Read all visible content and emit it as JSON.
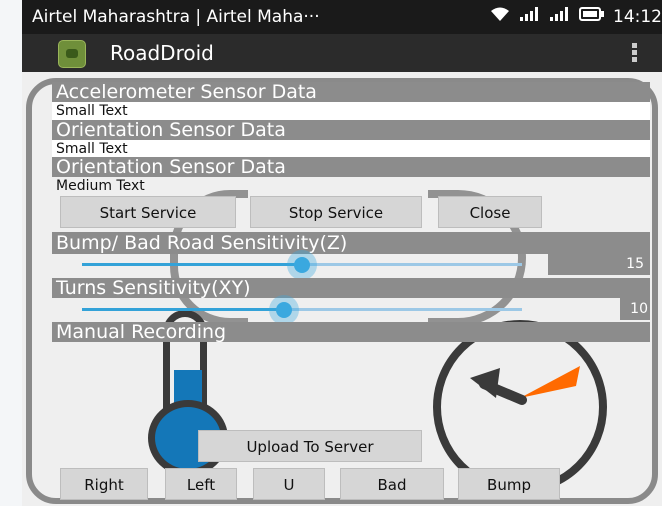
{
  "status_bar": {
    "carrier": "Airtel Maharashtra | Airtel Maha···",
    "time": "14:12"
  },
  "action_bar": {
    "title": "RoadDroid"
  },
  "sections": {
    "accelerometer_header": "Accelerometer Sensor Data",
    "accelerometer_text": "Small Text",
    "orientation1_header": "Orientation Sensor Data",
    "orientation1_text": "Small Text",
    "orientation2_header": "Orientation Sensor Data",
    "orientation2_text": "Medium Text"
  },
  "service_buttons": {
    "start": "Start Service",
    "stop": "Stop Service",
    "close": "Close"
  },
  "bump_sensitivity": {
    "label": "Bump/ Bad Road Sensitivity(Z)",
    "value": "15",
    "level": 0.5
  },
  "turn_sensitivity": {
    "label": "Turns Sensitivity(XY)",
    "value": "10",
    "level": 0.46
  },
  "manual_recording": {
    "label": "Manual Recording"
  },
  "upload_button": "Upload To Server",
  "bottom_buttons": {
    "right": "Right",
    "left": "Left",
    "u": "U",
    "bad": "Bad",
    "bump": "Bump"
  },
  "colors": {
    "accent": "#33a2d8",
    "header_gray": "#8c8c8c",
    "thermometer_blue": "#1477b8",
    "gauge_orange": "#ff6a00"
  }
}
